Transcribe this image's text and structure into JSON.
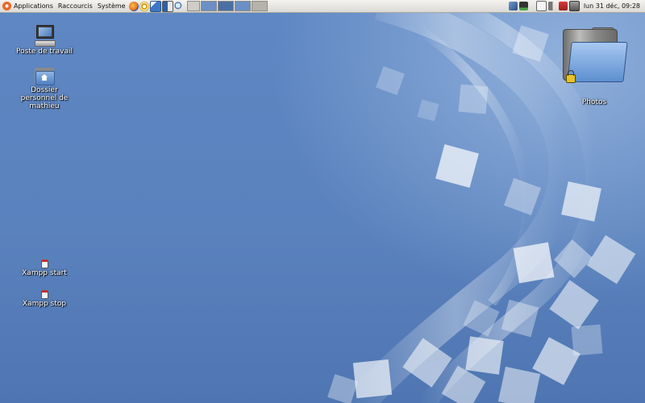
{
  "panel": {
    "menus": {
      "applications": "Applications",
      "places": "Raccourcis",
      "system": "Système"
    },
    "launchers": [
      {
        "name": "firefox-icon",
        "color": "#e66a1f"
      },
      {
        "name": "help-icon",
        "color": "#d2a31e"
      },
      {
        "name": "writer-icon",
        "color": "#3d78c6"
      },
      {
        "name": "dictionary-icon",
        "color": "#2f5fa5"
      },
      {
        "name": "search-icon",
        "color": "#8fb3d9"
      }
    ],
    "workspaces": [
      "workspace-1",
      "workspace-2",
      "workspace-3",
      "workspace-4"
    ],
    "tray": [
      "network-icon",
      "monitor-icon",
      "clipboard-icon",
      "volume-icon",
      "power-icon",
      "display-icon"
    ],
    "clock": "lun 31 déc, 09:28"
  },
  "desktop": {
    "icons": {
      "computer": "Poste de travail",
      "home": "Dossier personnel de mathieu",
      "xampp_start": "Xampp start",
      "xampp_stop": "Xampp stop",
      "photos": "Photos"
    }
  },
  "theme": {
    "panel_bg": "#dcdad5",
    "desktop_bg": "#5a83c0",
    "accent": "#4a6fa5"
  }
}
